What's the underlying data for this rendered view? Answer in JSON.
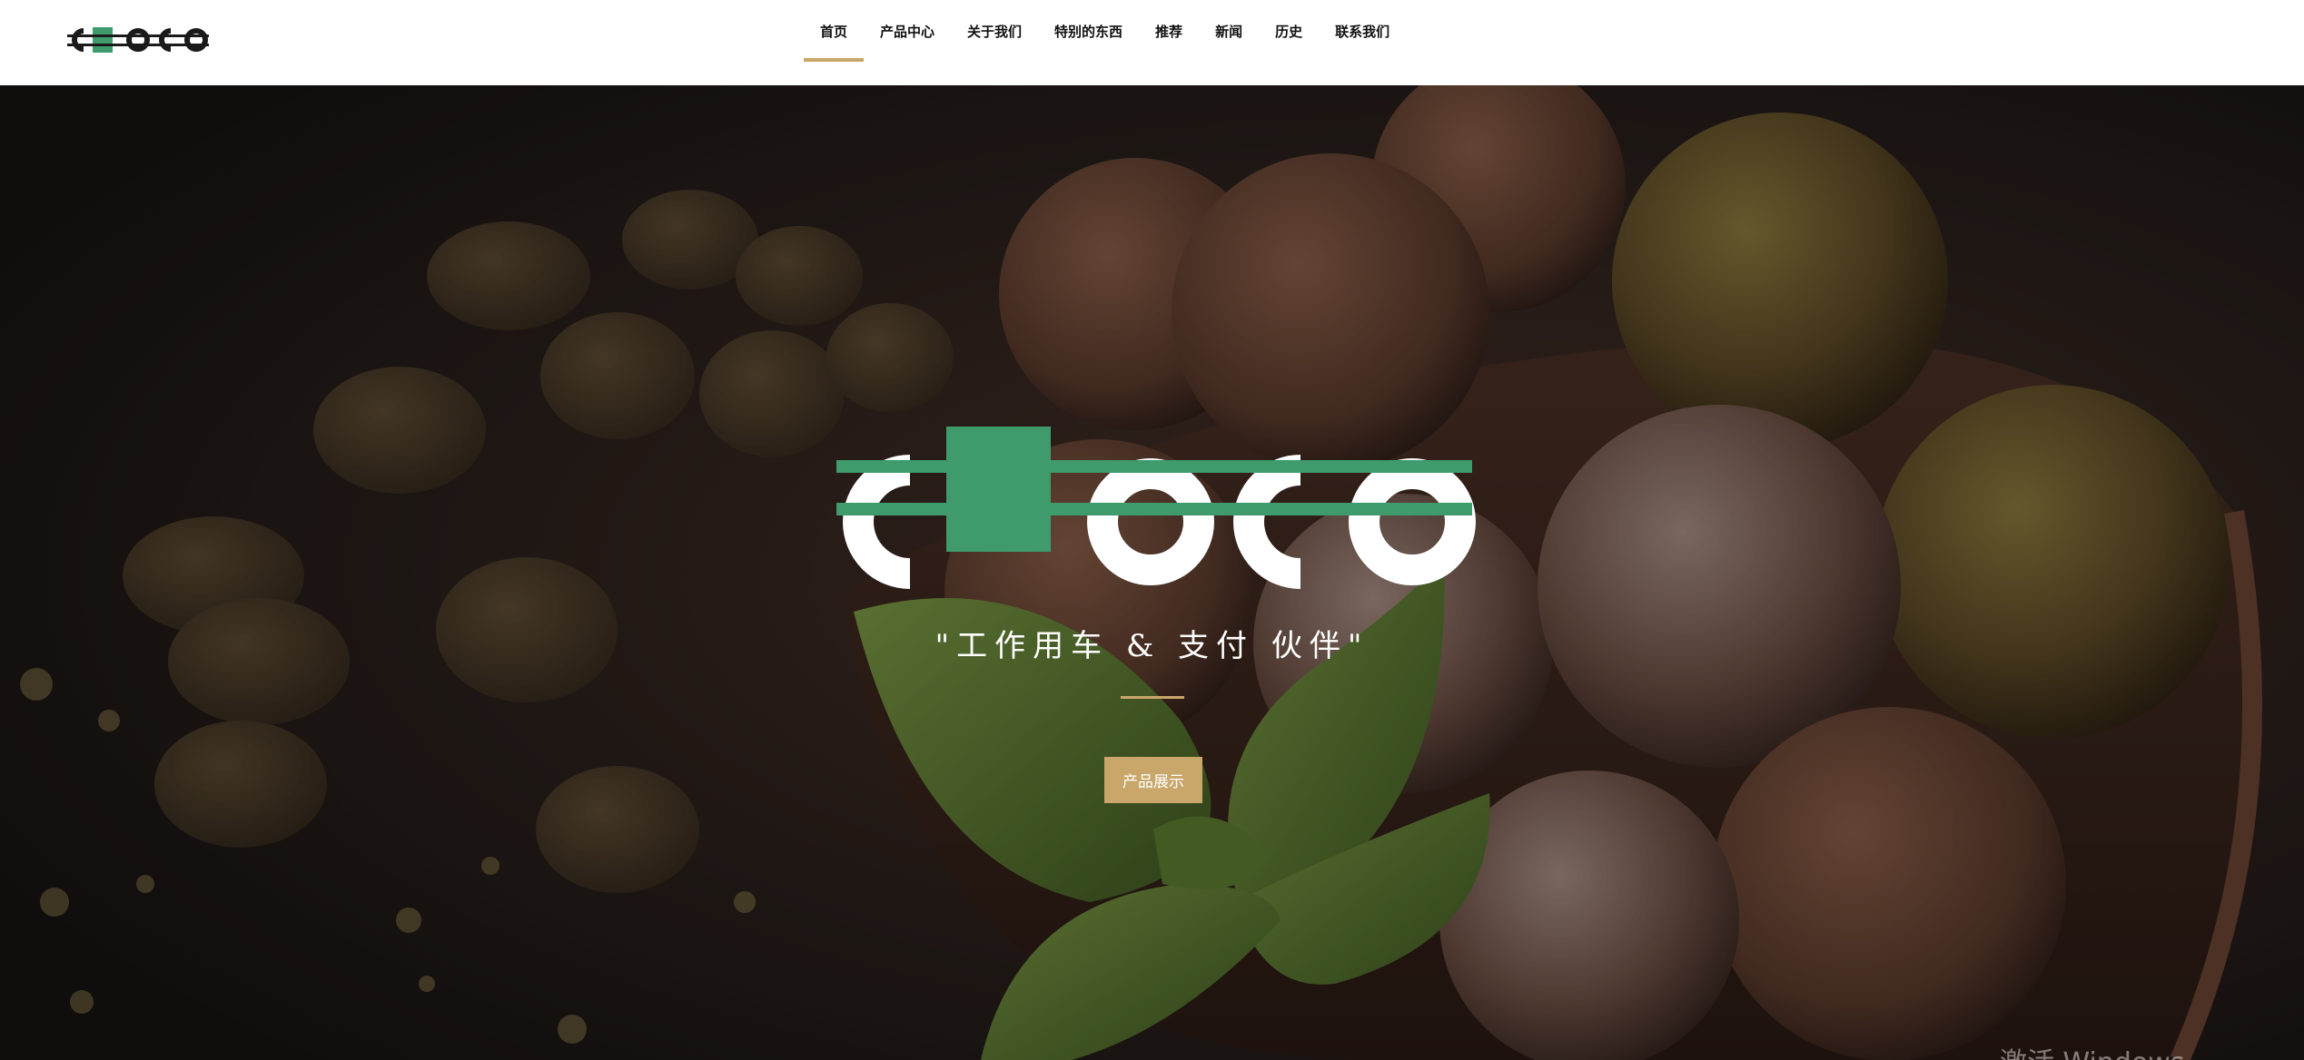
{
  "brand": {
    "logo_text": "CHOCO",
    "accent_color": "#c9a76a",
    "logo_green": "#3f9a6c"
  },
  "nav": {
    "items": [
      {
        "label": "首页",
        "active": true
      },
      {
        "label": "产品中心"
      },
      {
        "label": "关于我们"
      },
      {
        "label": "特别的东西"
      },
      {
        "label": "推荐"
      },
      {
        "label": "新闻"
      },
      {
        "label": "历史"
      },
      {
        "label": "联系我们"
      }
    ]
  },
  "hero": {
    "tagline": "\"工作用车 & 支付 伙伴\"",
    "cta_label": "产品展示",
    "watermark": "激活 Windows"
  }
}
